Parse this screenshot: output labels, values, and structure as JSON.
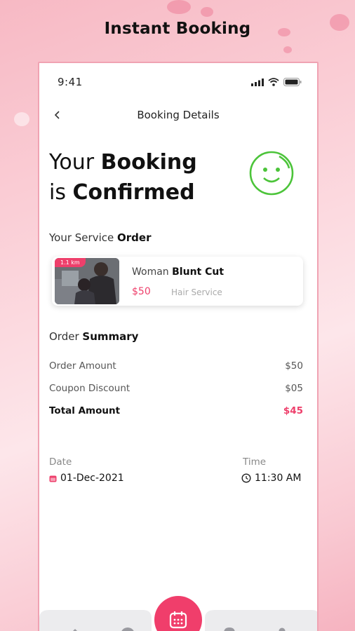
{
  "headline": "Instant Booking",
  "status_bar": {
    "time": "9:41"
  },
  "nav": {
    "title": "Booking Details"
  },
  "confirmation": {
    "line1_light": "Your",
    "line1_bold": "Booking",
    "line2_light": "is",
    "line2_bold": "Confirmed"
  },
  "service_section": {
    "label_light": "Your Service",
    "label_bold": "Order"
  },
  "service": {
    "distance": "1.1 km",
    "name_light": "Woman",
    "name_bold": "Blunt Cut",
    "price": "$50",
    "type": "Hair Service"
  },
  "summary_section": {
    "label_light": "Order",
    "label_bold": "Summary"
  },
  "summary": [
    {
      "label": "Order Amount",
      "value": "$50"
    },
    {
      "label": "Coupon Discount",
      "value": "$05"
    },
    {
      "label": "Total Amount",
      "value": "$45"
    }
  ],
  "date": {
    "label": "Date",
    "value": "01-Dec-2021"
  },
  "time": {
    "label": "Time",
    "value": "11:30 AM"
  },
  "colors": {
    "accent": "#EE3F6B",
    "success": "#4CC43A"
  },
  "icons": [
    "signal-icon",
    "wifi-icon",
    "battery-icon",
    "back-chevron-icon",
    "smiley-icon",
    "calendar-icon",
    "clock-icon",
    "home-icon",
    "explore-icon",
    "booking-calendar-icon",
    "location-icon",
    "profile-icon"
  ]
}
